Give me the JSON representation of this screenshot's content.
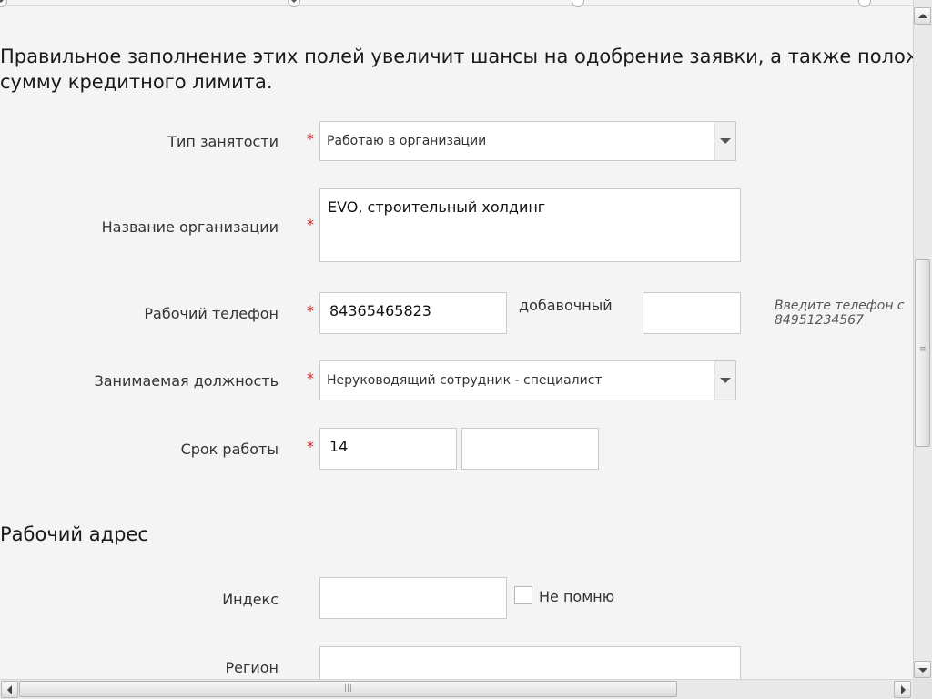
{
  "intro": {
    "line1": "Правильное заполнение этих полей увеличит шансы на одобрение заявки, а также полож",
    "line2": "сумму кредитного лимита."
  },
  "required_mark": "*",
  "employment": {
    "type_label": "Тип занятости",
    "type_value": "Работаю в организации",
    "org_label": "Название организации",
    "org_value": "EVO, строительный холдинг",
    "phone_label": "Рабочий телефон",
    "phone_value": "84365465823",
    "ext_label": "добавочный",
    "ext_value": "",
    "phone_hint_line1": "Введите телефон с",
    "phone_hint_line2": "84951234567",
    "position_label": "Занимаемая должность",
    "position_value": "Неруководящий сотрудник - специалист",
    "tenure_label": "Срок работы",
    "tenure_years": "14",
    "tenure_months": ""
  },
  "work_address": {
    "title": "Рабочий адрес",
    "index_label": "Индекс",
    "index_value": "",
    "dont_remember_label": "Не помню",
    "region_label": "Регион",
    "region_value": ""
  },
  "icons": {
    "select_arrow": "chevron-down-icon",
    "scroll_up": "arrow-up-icon",
    "scroll_down": "arrow-down-icon",
    "scroll_left": "arrow-left-icon",
    "scroll_right": "arrow-right-icon"
  },
  "colors": {
    "background": "#f4f4f4",
    "required": "#d0202a",
    "field_border": "#c9c9c9"
  }
}
